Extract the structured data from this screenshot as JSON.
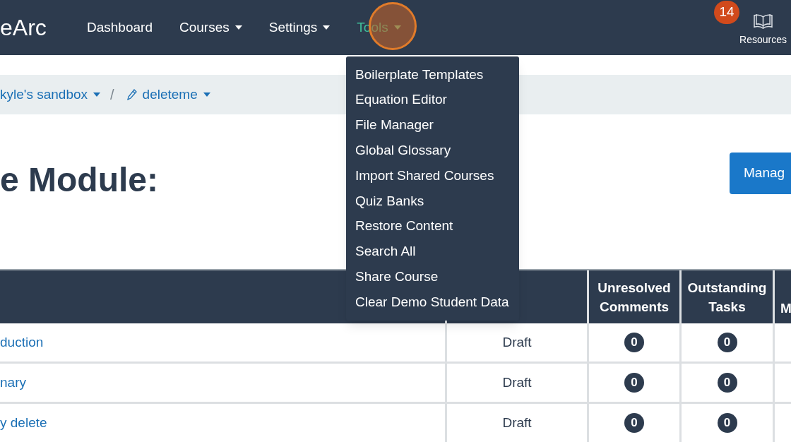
{
  "navbar": {
    "brand": "eArc",
    "items": [
      {
        "label": "Dashboard",
        "dropdown": false,
        "active": false,
        "highlighted": false
      },
      {
        "label": "Courses",
        "dropdown": true,
        "active": false,
        "highlighted": false
      },
      {
        "label": "Settings",
        "dropdown": true,
        "active": false,
        "highlighted": false
      },
      {
        "label": "Tools",
        "dropdown": true,
        "active": true,
        "highlighted": true
      }
    ],
    "notification_count": "14",
    "resources_label": "Resources"
  },
  "breadcrumb": {
    "separator": "/",
    "items": [
      {
        "label": "kyle's sandbox",
        "dropdown": true,
        "kind": "course"
      },
      {
        "label": "deleteme",
        "dropdown": true,
        "kind": "module"
      }
    ]
  },
  "page_title": "e Module:",
  "manage_button": "Manag",
  "tools_menu": [
    "Boilerplate Templates",
    "Equation Editor",
    "File Manager",
    "Global Glossary",
    "Import Shared Courses",
    "Quiz Banks",
    "Restore Content",
    "Search All",
    "Share Course",
    "Clear Demo Student Data"
  ],
  "table": {
    "columns": [
      "",
      "",
      "Unresolved Comments",
      "Outstanding Tasks",
      "M"
    ],
    "rows": [
      {
        "title": "duction",
        "status": "Draft",
        "comments": "0",
        "tasks": "0"
      },
      {
        "title": "nary",
        "status": "Draft",
        "comments": "0",
        "tasks": "0"
      },
      {
        "title": "y delete",
        "status": "Draft",
        "comments": "0",
        "tasks": "0"
      }
    ]
  }
}
